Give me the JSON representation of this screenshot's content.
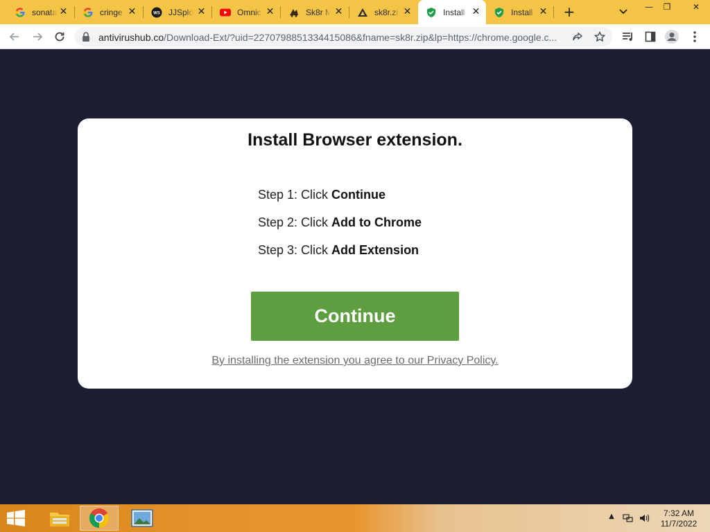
{
  "browser": {
    "tabs": [
      {
        "title": "sonata",
        "icon": "google-icon"
      },
      {
        "title": "cringe",
        "icon": "google-icon"
      },
      {
        "title": "JJSploit",
        "icon": "jjsploit-icon"
      },
      {
        "title": "Omnic",
        "icon": "youtube-icon"
      },
      {
        "title": "Sk8r M",
        "icon": "sk8r-icon"
      },
      {
        "title": "sk8r.zi",
        "icon": "sk8r-zip-icon"
      },
      {
        "title": "Install",
        "icon": "shield-icon"
      },
      {
        "title": "Install",
        "icon": "shield-icon"
      }
    ],
    "active_tab_index": 6,
    "url_host": "antivirushub.co",
    "url_path": "/Download-Ext/?uid=2270798851334415086&fname=sk8r.zip&lp=https://chrome.google.c..."
  },
  "page": {
    "title": "Install Browser extension.",
    "steps": [
      {
        "prefix": "Step 1: Click ",
        "action": "Continue"
      },
      {
        "prefix": "Step 2: Click ",
        "action": "Add to Chrome"
      },
      {
        "prefix": "Step 3: Click ",
        "action": "Add Extension"
      }
    ],
    "continue_label": "Continue",
    "policy_text": "By installing the extension you agree to our Privacy Policy."
  },
  "taskbar": {
    "time": "7:32 AM",
    "date": "11/7/2022"
  },
  "colors": {
    "tab_strip": "#f3c445",
    "page_background": "#1c1f33",
    "continue_button": "#5e9e41"
  }
}
